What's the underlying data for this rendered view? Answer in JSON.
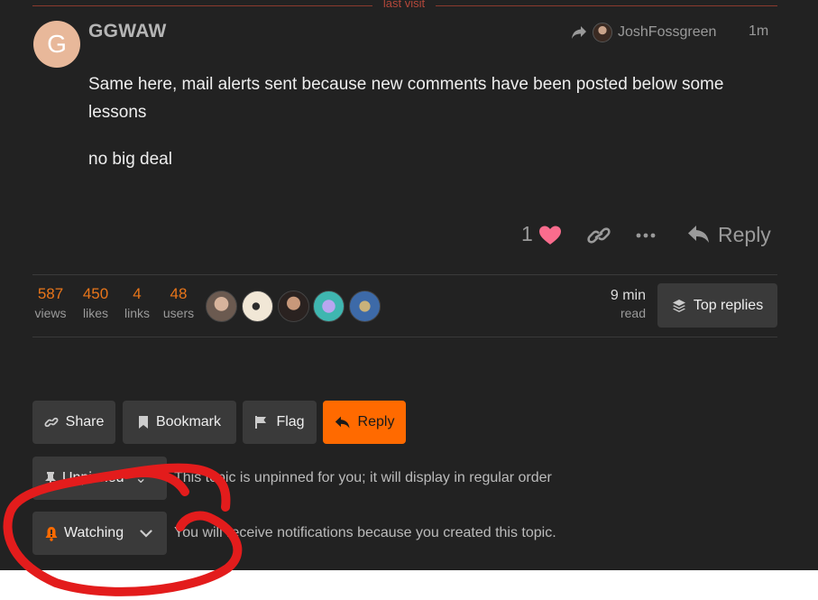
{
  "divider": {
    "label": "last visit"
  },
  "post": {
    "avatar_letter": "G",
    "username": "GGWAW",
    "reply_to_user": "JoshFossgreen",
    "age": "1m",
    "paragraphs": [
      "Same here, mail alerts sent because new comments have been posted below some lessons",
      "no big deal"
    ],
    "like_count": "1",
    "reply_label": "Reply"
  },
  "topic_map": {
    "stats": [
      {
        "value": "587",
        "label": "views"
      },
      {
        "value": "450",
        "label": "likes"
      },
      {
        "value": "4",
        "label": "links"
      },
      {
        "value": "48",
        "label": "users"
      }
    ],
    "read_time_value": "9 min",
    "read_time_label": "read",
    "top_replies_label": "Top replies"
  },
  "footer_buttons": {
    "share": "Share",
    "bookmark": "Bookmark",
    "flag": "Flag",
    "reply": "Reply"
  },
  "pin_status": {
    "button_label": "Unpinned",
    "description": "This topic is unpinned for you; it will display in regular order"
  },
  "notification": {
    "button_label": "Watching",
    "description": "You will receive notifications because you created this topic."
  },
  "colors": {
    "accent": "#ff6a00",
    "like_heart": "#fa6c8d",
    "background": "#222222",
    "annotation": "#e31c1c"
  }
}
